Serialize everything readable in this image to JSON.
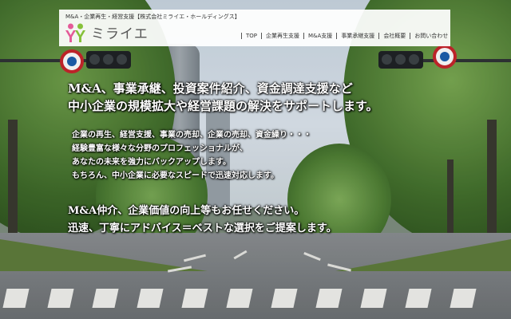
{
  "header": {
    "tagline": "M&A・企業再生・経営支援【株式会社ミライエ・ホールディングス】",
    "logo_text": "ミライエ",
    "logo_colors": {
      "left_figure": "#e45a98",
      "right_figure": "#86c13a"
    }
  },
  "nav": {
    "items": [
      {
        "label": "TOP"
      },
      {
        "label": "企業再生支援"
      },
      {
        "label": "M&A支援"
      },
      {
        "label": "事業承継支援"
      },
      {
        "label": "会社概要"
      },
      {
        "label": "お問い合わせ"
      }
    ]
  },
  "hero": {
    "main_line1": "M&A、事業承継、投資案件紹介、資金調達支援など",
    "main_line2": "中小企業の規模拡大や経営課題の解決をサポートします。",
    "sub_line1": "企業の再生、経営支援、事業の売却、企業の売却、資金繰り・・・",
    "sub_line2": "経験豊富な様々な分野のプロフェッショナルが、",
    "sub_line3": "あなたの未来を強力にバックアップします。",
    "sub_line4": "もちろん、中小企業に必要なスピードで迅速対応します。",
    "closing_line1": "M&A仲介、企業価値の向上等もお任せください。",
    "closing_line2": "迅速、丁寧にアドバイス＝ベストな選択をご提案します。"
  }
}
